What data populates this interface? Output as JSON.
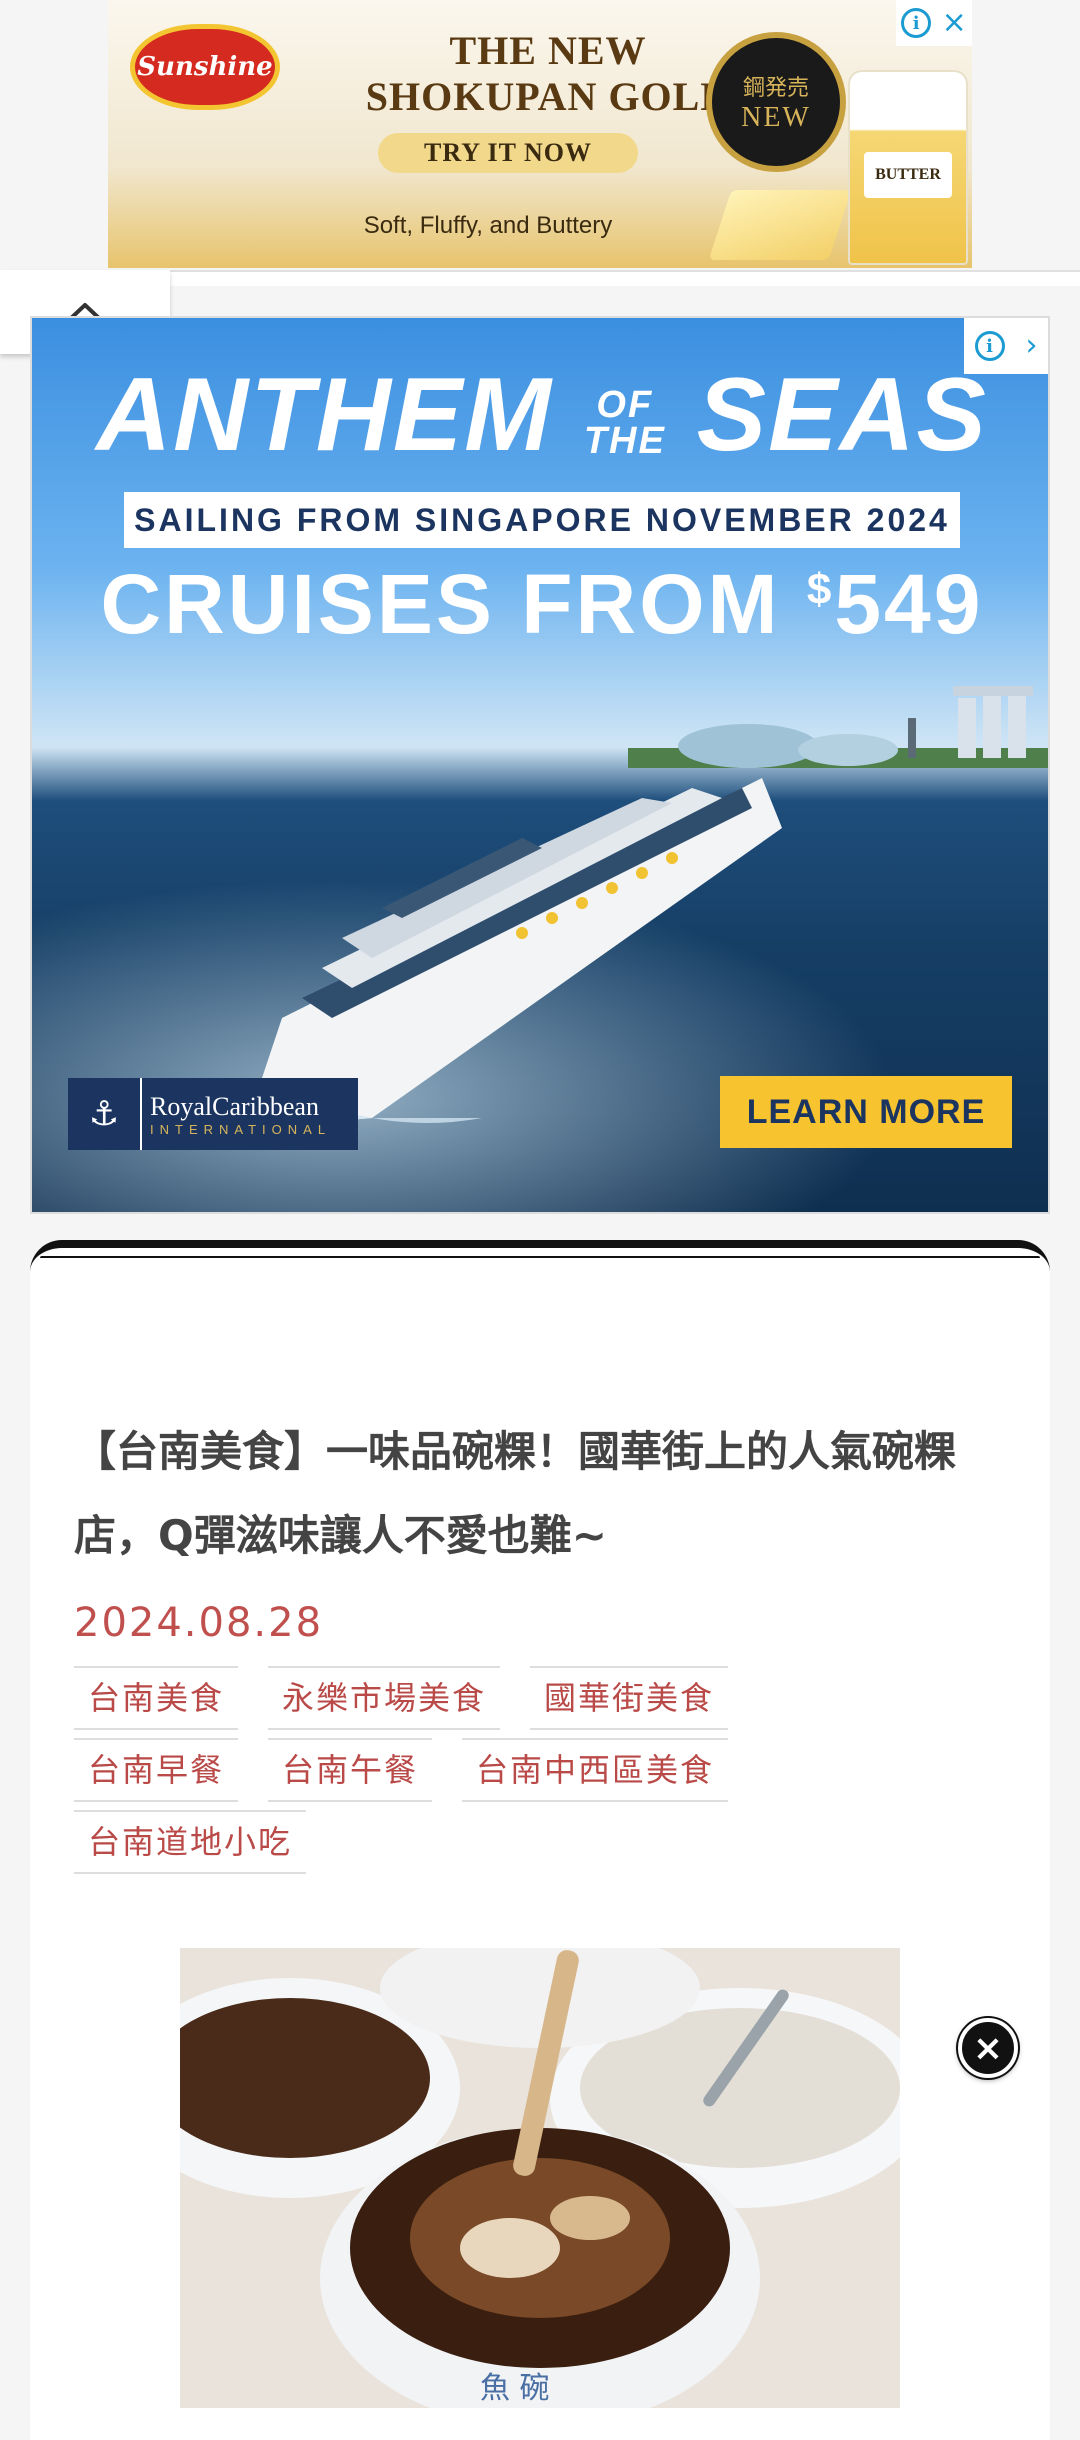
{
  "ad_top": {
    "brand": "Sunshine",
    "headline_line1": "THE NEW",
    "headline_line2": "SHOKUPAN GOLD",
    "cta": "TRY IT NOW",
    "tagline": "Soft, Fluffy, and Buttery",
    "badge_zh": "鋼発売",
    "badge_en": "NEW",
    "product_label": "BUTTER",
    "info_icon": "i",
    "close_icon": "×"
  },
  "collapse": {
    "icon": "chevron-up"
  },
  "ad_main": {
    "title_left": "ANTHEM",
    "title_of": "OF",
    "title_the": "THE",
    "title_right": "SEAS",
    "banner": "SAILING FROM SINGAPORE NOVEMBER 2024",
    "price_prefix": "CRUISES FROM ",
    "price_currency": "$",
    "price_value": "549",
    "logo_brand": "RoyalCaribbean",
    "logo_sub": "INTERNATIONAL",
    "cta": "LEARN MORE",
    "info_icon": "i",
    "close_icon": "›"
  },
  "article": {
    "title": "【台南美食】一味品碗粿！國華街上的人氣碗粿店，Q彈滋味讓人不愛也難~",
    "date": "2024.08.28",
    "tags": [
      [
        "台南美食",
        "永樂市場美食",
        "國華街美食"
      ],
      [
        "台南早餐",
        "台南午餐",
        "台南中西區美食"
      ],
      [
        "台南道地小吃"
      ]
    ]
  },
  "floating_close": {
    "icon": "×"
  }
}
